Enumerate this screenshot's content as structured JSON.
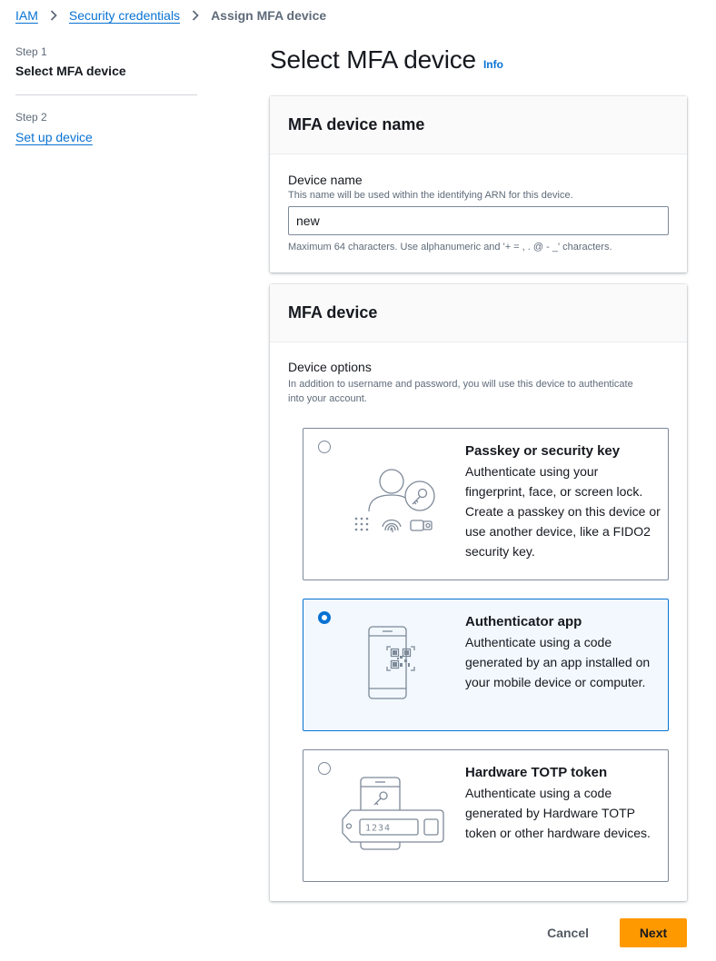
{
  "breadcrumb": {
    "items": [
      {
        "label": "IAM"
      },
      {
        "label": "Security credentials"
      },
      {
        "label": "Assign MFA device"
      }
    ]
  },
  "steps": {
    "step1": {
      "number": "Step 1",
      "title": "Select MFA device"
    },
    "step2": {
      "number": "Step 2",
      "title": "Set up device"
    }
  },
  "header": {
    "title": "Select MFA device",
    "info": "Info"
  },
  "device_name_section": {
    "title": "MFA device name",
    "label": "Device name",
    "description": "This name will be used within the identifying ARN for this device.",
    "value": "new",
    "constraint": "Maximum 64 characters. Use alphanumeric and '+ = , . @ - _' characters."
  },
  "mfa_device_section": {
    "title": "MFA device",
    "options_label": "Device options",
    "options_description": "In addition to username and password, you will use this device to authenticate into your account.",
    "options": [
      {
        "title": "Passkey or security key",
        "description": "Authenticate using your fingerprint, face, or screen lock. Create a passkey on this device or use another device, like a FIDO2 security key.",
        "selected": false,
        "icon": "passkey-illustration"
      },
      {
        "title": "Authenticator app",
        "description": "Authenticate using a code generated by an app installed on your mobile device or computer.",
        "selected": true,
        "icon": "authenticator-app-illustration"
      },
      {
        "title": "Hardware TOTP token",
        "description": "Authenticate using a code generated by Hardware TOTP token or other hardware devices.",
        "selected": false,
        "icon": "hardware-token-illustration",
        "token_display": "1234"
      }
    ]
  },
  "actions": {
    "cancel": "Cancel",
    "next": "Next"
  },
  "colors": {
    "link": "#0972d3",
    "primary_button": "#ff9900",
    "selected_tile_bg": "#f2f8fd"
  }
}
